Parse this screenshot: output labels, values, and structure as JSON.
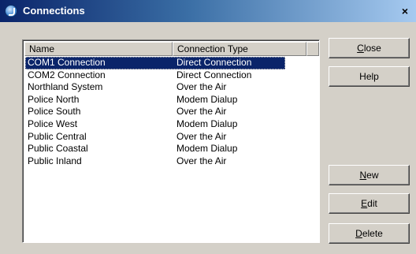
{
  "window": {
    "title": "Connections",
    "close_glyph": "×"
  },
  "list": {
    "columns": [
      "Name",
      "Connection Type",
      ""
    ],
    "rows": [
      {
        "name": "COM1 Connection",
        "type": "Direct Connection",
        "selected": true
      },
      {
        "name": "COM2 Connection",
        "type": "Direct Connection"
      },
      {
        "name": "Northland System",
        "type": "Over the Air"
      },
      {
        "name": "Police North",
        "type": "Modem Dialup"
      },
      {
        "name": "Police South",
        "type": "Over the Air"
      },
      {
        "name": "Police West",
        "type": "Modem Dialup"
      },
      {
        "name": "Public Central",
        "type": "Over the Air"
      },
      {
        "name": "Public Coastal",
        "type": "Modem Dialup"
      },
      {
        "name": "Public Inland",
        "type": "Over the Air"
      }
    ]
  },
  "buttons": {
    "close": {
      "mnemonic": "C",
      "rest": "lose"
    },
    "help": {
      "label": "Help"
    },
    "new": {
      "mnemonic": "N",
      "rest": "ew"
    },
    "edit": {
      "mnemonic": "E",
      "rest": "dit"
    },
    "delete": {
      "mnemonic": "D",
      "rest": "elete"
    }
  },
  "colors": {
    "dialog_bg": "#d4d0c8",
    "titlebar_start": "#0a246a",
    "titlebar_end": "#a6caf0",
    "selection": "#0a246a"
  }
}
